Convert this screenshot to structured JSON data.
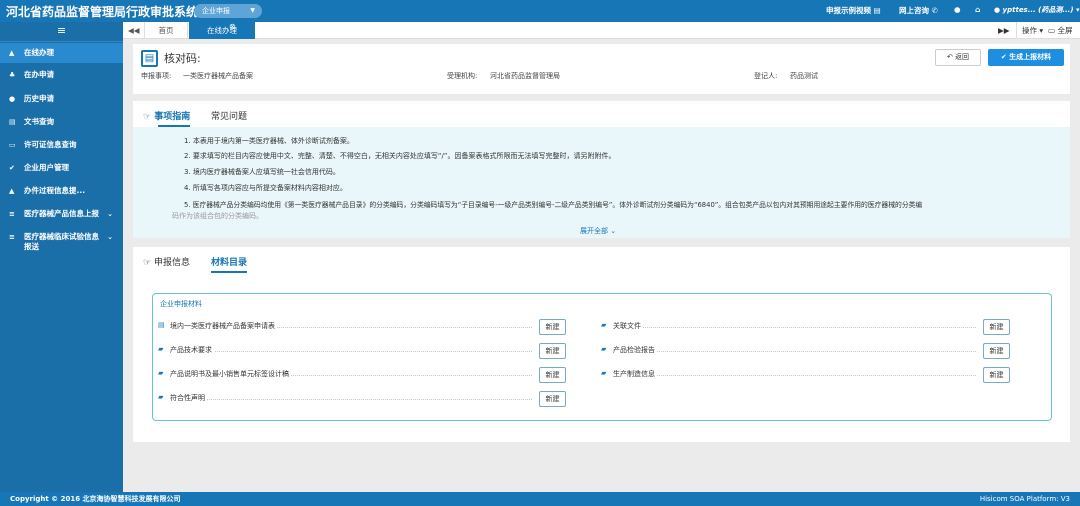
{
  "topbar": {
    "title": "河北省药品监督管理局行政审批系统",
    "enterprise_dropdown": "企业申报",
    "nav": {
      "demo_video": "申报示例视频",
      "online_consult": "网上咨询",
      "user": "ypttes... (药品测...)"
    }
  },
  "sidebar": {
    "menu_icon": "hamburger-icon",
    "items": [
      {
        "label": "在线办理",
        "icon": "bell-icon",
        "active": true
      },
      {
        "label": "在办申请",
        "icon": "tree-icon"
      },
      {
        "label": "历史申请",
        "icon": "comment-icon"
      },
      {
        "label": "文书查询",
        "icon": "document-icon"
      },
      {
        "label": "许可证信息查询",
        "icon": "card-icon"
      },
      {
        "label": "企业用户管理",
        "icon": "check-circle-icon"
      },
      {
        "label": "办件过程信息提...",
        "icon": "bell-icon"
      },
      {
        "label": "医疗器械产品信息上报",
        "icon": "list-icon"
      },
      {
        "label": "医疗器械临床试验信息报送",
        "icon": "list-icon"
      }
    ]
  },
  "tabbar": {
    "home": "首页",
    "active": "在线办理",
    "operations": "操作",
    "fullscreen": "全屏"
  },
  "header": {
    "verify_label": "核对码:",
    "item_label": "申报事项:",
    "item_value": "一类医疗器械产品备案",
    "org_label": "受理机构:",
    "org_value": "河北省药品监督管理局",
    "registrant_label": "登记人:",
    "registrant_value": "药品测试",
    "back_button": "返回",
    "generate_button": "生成上报材料"
  },
  "guide": {
    "tab_active": "事项指南",
    "tab_other": "常见问题",
    "lines": [
      "1. 本表用于境内第一类医疗器械、体外诊断试剂备案。",
      "2. 要求填写的栏目内容应使用中文、完整、清楚、不得空白，无相关内容处应填写“/”。因备案表格式所限而无法填写完整时，请另附附件。",
      "3. 境内医疗器械备案人应填写统一社会信用代码。",
      "4. 所填写各项内容应与所提交备案材料内容相对应。",
      "5. 医疗器械产品分类编码均使用《第一类医疗器械产品目录》的分类编码，分类编码填写为“子目录编号-一级产品类别编号-二级产品类别编号”。体外诊断试剂分类编码为“6840”。组合包类产品以包内对其预期用途起主要作用的医疗器械的分类编",
      "码作为该组合包的分类编码。"
    ],
    "expand": "展开全部"
  },
  "materials": {
    "tab_info": "申报信息",
    "tab_active": "材料目录",
    "box_title": "企业申报材料",
    "new_label": "新建",
    "left": [
      {
        "name": "境内一类医疗器械产品备案申请表",
        "icon": "document-icon"
      },
      {
        "name": "产品技术要求",
        "icon": "folder-icon"
      },
      {
        "name": "产品说明书及最小销售单元标签设计稿",
        "icon": "folder-icon"
      },
      {
        "name": "符合性声明",
        "icon": "folder-icon"
      }
    ],
    "right": [
      {
        "name": "关联文件",
        "icon": "folder-icon"
      },
      {
        "name": "产品检验报告",
        "icon": "folder-icon"
      },
      {
        "name": "生产制造信息",
        "icon": "folder-icon"
      }
    ]
  },
  "footer": {
    "copyright": "Copyright © 2016 北京海协智慧科技发展有限公司",
    "platform": "Hisicom SOA Platform:  V3"
  },
  "colors": {
    "primary": "#1776b6",
    "sidebar": "#1a6fa8",
    "button_blue": "#1c8fe0",
    "guide_bg": "#eaf7fa"
  }
}
